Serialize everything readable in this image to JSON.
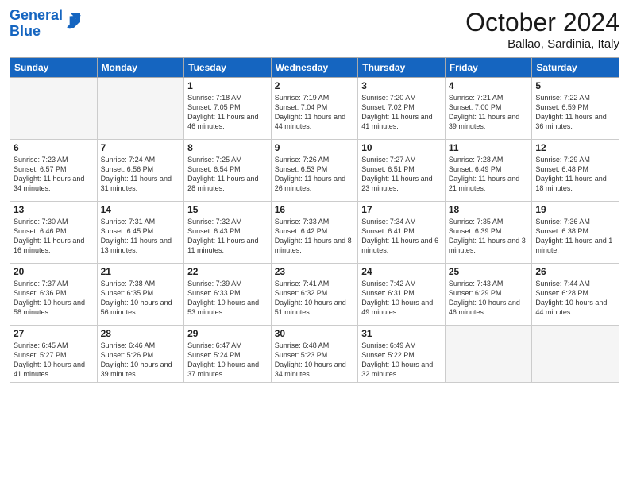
{
  "logo": {
    "line1": "General",
    "line2": "Blue"
  },
  "title": "October 2024",
  "location": "Ballao, Sardinia, Italy",
  "days_of_week": [
    "Sunday",
    "Monday",
    "Tuesday",
    "Wednesday",
    "Thursday",
    "Friday",
    "Saturday"
  ],
  "weeks": [
    [
      {
        "day": "",
        "sunrise": "",
        "sunset": "",
        "daylight": ""
      },
      {
        "day": "",
        "sunrise": "",
        "sunset": "",
        "daylight": ""
      },
      {
        "day": "1",
        "sunrise": "Sunrise: 7:18 AM",
        "sunset": "Sunset: 7:05 PM",
        "daylight": "Daylight: 11 hours and 46 minutes."
      },
      {
        "day": "2",
        "sunrise": "Sunrise: 7:19 AM",
        "sunset": "Sunset: 7:04 PM",
        "daylight": "Daylight: 11 hours and 44 minutes."
      },
      {
        "day": "3",
        "sunrise": "Sunrise: 7:20 AM",
        "sunset": "Sunset: 7:02 PM",
        "daylight": "Daylight: 11 hours and 41 minutes."
      },
      {
        "day": "4",
        "sunrise": "Sunrise: 7:21 AM",
        "sunset": "Sunset: 7:00 PM",
        "daylight": "Daylight: 11 hours and 39 minutes."
      },
      {
        "day": "5",
        "sunrise": "Sunrise: 7:22 AM",
        "sunset": "Sunset: 6:59 PM",
        "daylight": "Daylight: 11 hours and 36 minutes."
      }
    ],
    [
      {
        "day": "6",
        "sunrise": "Sunrise: 7:23 AM",
        "sunset": "Sunset: 6:57 PM",
        "daylight": "Daylight: 11 hours and 34 minutes."
      },
      {
        "day": "7",
        "sunrise": "Sunrise: 7:24 AM",
        "sunset": "Sunset: 6:56 PM",
        "daylight": "Daylight: 11 hours and 31 minutes."
      },
      {
        "day": "8",
        "sunrise": "Sunrise: 7:25 AM",
        "sunset": "Sunset: 6:54 PM",
        "daylight": "Daylight: 11 hours and 28 minutes."
      },
      {
        "day": "9",
        "sunrise": "Sunrise: 7:26 AM",
        "sunset": "Sunset: 6:53 PM",
        "daylight": "Daylight: 11 hours and 26 minutes."
      },
      {
        "day": "10",
        "sunrise": "Sunrise: 7:27 AM",
        "sunset": "Sunset: 6:51 PM",
        "daylight": "Daylight: 11 hours and 23 minutes."
      },
      {
        "day": "11",
        "sunrise": "Sunrise: 7:28 AM",
        "sunset": "Sunset: 6:49 PM",
        "daylight": "Daylight: 11 hours and 21 minutes."
      },
      {
        "day": "12",
        "sunrise": "Sunrise: 7:29 AM",
        "sunset": "Sunset: 6:48 PM",
        "daylight": "Daylight: 11 hours and 18 minutes."
      }
    ],
    [
      {
        "day": "13",
        "sunrise": "Sunrise: 7:30 AM",
        "sunset": "Sunset: 6:46 PM",
        "daylight": "Daylight: 11 hours and 16 minutes."
      },
      {
        "day": "14",
        "sunrise": "Sunrise: 7:31 AM",
        "sunset": "Sunset: 6:45 PM",
        "daylight": "Daylight: 11 hours and 13 minutes."
      },
      {
        "day": "15",
        "sunrise": "Sunrise: 7:32 AM",
        "sunset": "Sunset: 6:43 PM",
        "daylight": "Daylight: 11 hours and 11 minutes."
      },
      {
        "day": "16",
        "sunrise": "Sunrise: 7:33 AM",
        "sunset": "Sunset: 6:42 PM",
        "daylight": "Daylight: 11 hours and 8 minutes."
      },
      {
        "day": "17",
        "sunrise": "Sunrise: 7:34 AM",
        "sunset": "Sunset: 6:41 PM",
        "daylight": "Daylight: 11 hours and 6 minutes."
      },
      {
        "day": "18",
        "sunrise": "Sunrise: 7:35 AM",
        "sunset": "Sunset: 6:39 PM",
        "daylight": "Daylight: 11 hours and 3 minutes."
      },
      {
        "day": "19",
        "sunrise": "Sunrise: 7:36 AM",
        "sunset": "Sunset: 6:38 PM",
        "daylight": "Daylight: 11 hours and 1 minute."
      }
    ],
    [
      {
        "day": "20",
        "sunrise": "Sunrise: 7:37 AM",
        "sunset": "Sunset: 6:36 PM",
        "daylight": "Daylight: 10 hours and 58 minutes."
      },
      {
        "day": "21",
        "sunrise": "Sunrise: 7:38 AM",
        "sunset": "Sunset: 6:35 PM",
        "daylight": "Daylight: 10 hours and 56 minutes."
      },
      {
        "day": "22",
        "sunrise": "Sunrise: 7:39 AM",
        "sunset": "Sunset: 6:33 PM",
        "daylight": "Daylight: 10 hours and 53 minutes."
      },
      {
        "day": "23",
        "sunrise": "Sunrise: 7:41 AM",
        "sunset": "Sunset: 6:32 PM",
        "daylight": "Daylight: 10 hours and 51 minutes."
      },
      {
        "day": "24",
        "sunrise": "Sunrise: 7:42 AM",
        "sunset": "Sunset: 6:31 PM",
        "daylight": "Daylight: 10 hours and 49 minutes."
      },
      {
        "day": "25",
        "sunrise": "Sunrise: 7:43 AM",
        "sunset": "Sunset: 6:29 PM",
        "daylight": "Daylight: 10 hours and 46 minutes."
      },
      {
        "day": "26",
        "sunrise": "Sunrise: 7:44 AM",
        "sunset": "Sunset: 6:28 PM",
        "daylight": "Daylight: 10 hours and 44 minutes."
      }
    ],
    [
      {
        "day": "27",
        "sunrise": "Sunrise: 6:45 AM",
        "sunset": "Sunset: 5:27 PM",
        "daylight": "Daylight: 10 hours and 41 minutes."
      },
      {
        "day": "28",
        "sunrise": "Sunrise: 6:46 AM",
        "sunset": "Sunset: 5:26 PM",
        "daylight": "Daylight: 10 hours and 39 minutes."
      },
      {
        "day": "29",
        "sunrise": "Sunrise: 6:47 AM",
        "sunset": "Sunset: 5:24 PM",
        "daylight": "Daylight: 10 hours and 37 minutes."
      },
      {
        "day": "30",
        "sunrise": "Sunrise: 6:48 AM",
        "sunset": "Sunset: 5:23 PM",
        "daylight": "Daylight: 10 hours and 34 minutes."
      },
      {
        "day": "31",
        "sunrise": "Sunrise: 6:49 AM",
        "sunset": "Sunset: 5:22 PM",
        "daylight": "Daylight: 10 hours and 32 minutes."
      },
      {
        "day": "",
        "sunrise": "",
        "sunset": "",
        "daylight": ""
      },
      {
        "day": "",
        "sunrise": "",
        "sunset": "",
        "daylight": ""
      }
    ]
  ]
}
